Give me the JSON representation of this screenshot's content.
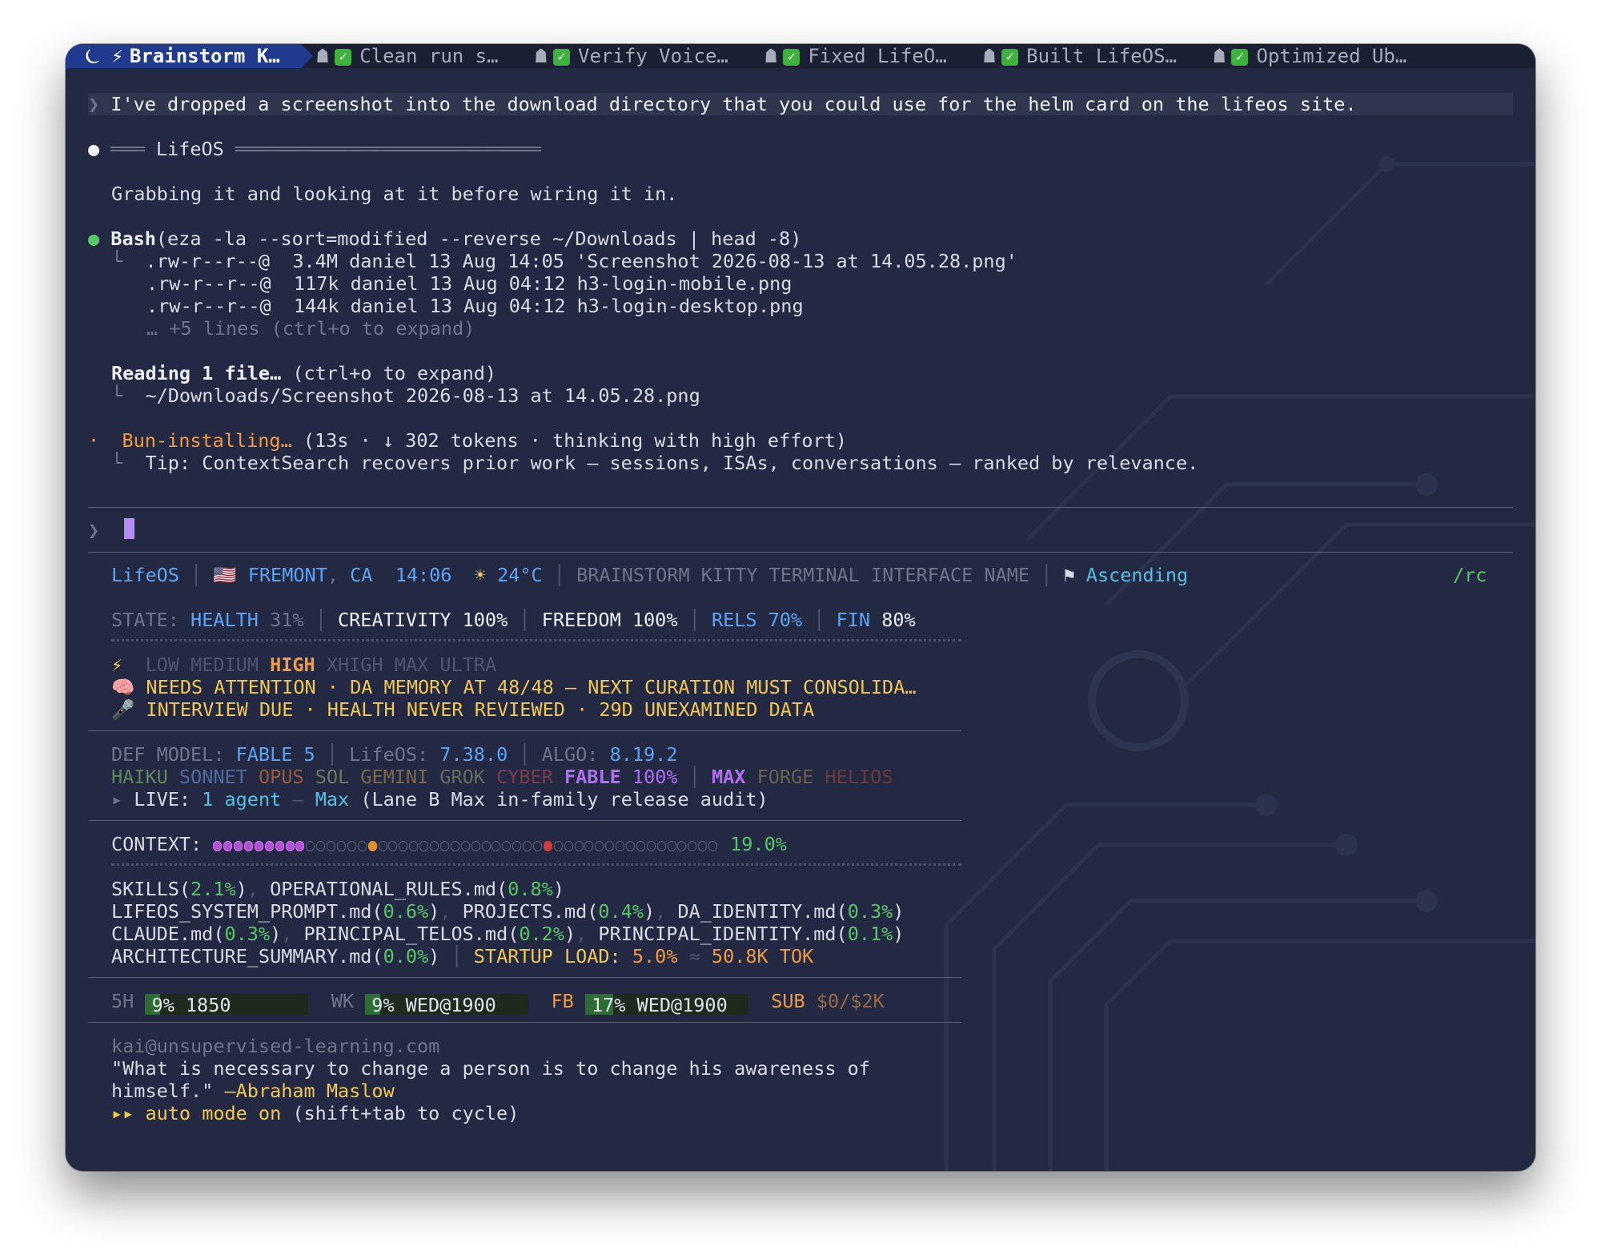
{
  "tabs": [
    {
      "label": "Brainstorm K…",
      "active": true,
      "icons": "⏾ ⚡"
    },
    {
      "label": "Clean run s…",
      "icons": "☗"
    },
    {
      "label": "Verify Voice…",
      "icons": "☗"
    },
    {
      "label": "Fixed LifeO…",
      "icons": "☗"
    },
    {
      "label": "Built LifeOS…",
      "icons": "☗"
    },
    {
      "label": "Optimized Ub…",
      "icons": "☗"
    }
  ],
  "user_prompt": "I've dropped a screenshot into the download directory that you could use for the helm card on the lifeos site.",
  "section_header": "LifeOS",
  "reply": "Grabbing it and looking at it before wiring it in.",
  "bash": {
    "tool": "Bash",
    "command": "(eza -la --sort=modified --reverse ~/Downloads | head -8)",
    "lines": [
      ".rw-r--r--@  3.4M daniel 13 Aug 14:05 'Screenshot 2026-08-13 at 14.05.28.png'",
      ".rw-r--r--@  117k daniel 13 Aug 04:12 h3-login-mobile.png",
      ".rw-r--r--@  144k daniel 13 Aug 04:12 h3-login-desktop.png"
    ],
    "more": "… +5 lines (ctrl+o to expand)"
  },
  "reading": {
    "label": "Reading 1 file…",
    "hint": " (ctrl+o to expand)",
    "path": "~/Downloads/Screenshot 2026-08-13 at 14.05.28.png"
  },
  "status": {
    "verb": "Bun-installing…",
    "detail": " (13s · ↓ 302 tokens · thinking with high effort)",
    "tip": "Tip: ContextSearch recovers prior work — sessions, ISAs, conversations — ranked by relevance."
  },
  "statusline": {
    "brand": "LifeOS",
    "city": "FREMONT",
    "region": "CA",
    "time": "14:06",
    "weather": "24°C",
    "session": "BRAINSTORM KITTY TERMINAL INTERFACE NAME",
    "mode": "Ascending",
    "cmd": "/rc",
    "state_label": "STATE:",
    "state": [
      {
        "k": "HEALTH",
        "v": "31%"
      },
      {
        "k": "CREATIVITY",
        "v": "100%"
      },
      {
        "k": "FREEDOM",
        "v": "100%"
      },
      {
        "k": "RELS",
        "v": "70%"
      },
      {
        "k": "FIN",
        "v": "80%"
      }
    ],
    "effort": [
      "LOW",
      "MEDIUM",
      "HIGH",
      "XHIGH",
      "MAX",
      "ULTRA"
    ],
    "alert1": "NEEDS ATTENTION · DA MEMORY AT 48/48 — NEXT CURATION MUST CONSOLIDA…",
    "alert2": "INTERVIEW DUE · HEALTH NEVER REVIEWED · 29D UNEXAMINED DATA",
    "def_model_label": "DEF MODEL:",
    "def_model": "FABLE 5",
    "lifeos_label": "LifeOS:",
    "lifeos_version": "7.38.0",
    "algo_label": "ALGO:",
    "algo_version": "8.19.2",
    "models": [
      "HAIKU",
      "SONNET",
      "OPUS",
      "SOL",
      "GEMINI",
      "GROK",
      "CYBER",
      "FABLE"
    ],
    "fable_pct": "100%",
    "extra_models": [
      "MAX",
      "FORGE",
      "HELIOS"
    ],
    "live_label": "LIVE:",
    "live_agents": "1 agent",
    "live_sep": "—",
    "live_model": "Max",
    "live_detail": "(Lane B Max in-family release audit)",
    "context_label": "CONTEXT:",
    "context_pct": "19.0%",
    "context_fraction": 0.19,
    "files": [
      {
        "name": "SKILLS",
        "pct": "2.1%"
      },
      {
        "name": "OPERATIONAL_RULES.md",
        "pct": "0.8%"
      },
      {
        "name": "LIFEOS_SYSTEM_PROMPT.md",
        "pct": "0.6%"
      },
      {
        "name": "PROJECTS.md",
        "pct": "0.4%"
      },
      {
        "name": "DA_IDENTITY.md",
        "pct": "0.3%"
      },
      {
        "name": "CLAUDE.md",
        "pct": "0.3%"
      },
      {
        "name": "PRINCIPAL_TELOS.md",
        "pct": "0.2%"
      },
      {
        "name": "PRINCIPAL_IDENTITY.md",
        "pct": "0.1%"
      },
      {
        "name": "ARCHITECTURE_SUMMARY.md",
        "pct": "0.0%"
      }
    ],
    "startup_label": "STARTUP LOAD:",
    "startup_pct": "5.0%",
    "startup_tok": "50.8K TOK",
    "usage": [
      {
        "k": "5H",
        "text": "9% 1850",
        "fill": 0.09
      },
      {
        "k": "WK",
        "text": "9% WED@1900",
        "fill": 0.09
      },
      {
        "k": "FB",
        "text": "17% WED@1900",
        "fill": 0.17
      }
    ],
    "sub_label": "SUB",
    "sub_value": "$0/$2K",
    "email": "kai@unsupervised-learning.com",
    "quote1": "\"What is necessary to change a person is to change his awareness of",
    "quote2": "himself.\"",
    "quote_author": "—Abraham Maslow",
    "auto_mode": "auto mode on",
    "auto_hint": " (shift+tab to cycle)"
  }
}
